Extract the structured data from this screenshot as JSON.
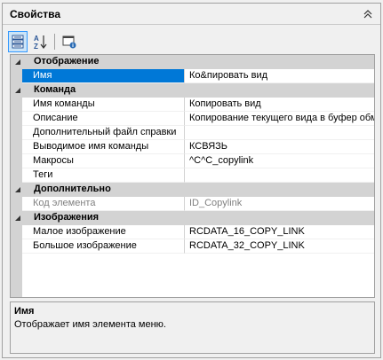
{
  "panel": {
    "title": "Свойства"
  },
  "toolbar": {
    "buttons": [
      {
        "name": "categorized-view",
        "active": true
      },
      {
        "name": "alphabetical-sort",
        "active": false
      },
      {
        "name": "property-pages",
        "active": false
      }
    ]
  },
  "grid": {
    "categories": [
      {
        "label": "Отображение",
        "properties": [
          {
            "name": "Имя",
            "value": "Ко&пировать вид",
            "selected": true
          }
        ]
      },
      {
        "label": "Команда",
        "properties": [
          {
            "name": "Имя команды",
            "value": "Копировать вид"
          },
          {
            "name": "Описание",
            "value": "Копирование текущего вида в буфер обм"
          },
          {
            "name": "Дополнительный файл справки",
            "value": ""
          },
          {
            "name": "Выводимое имя команды",
            "value": "КСВЯЗЬ"
          },
          {
            "name": "Макросы",
            "value": "^C^C_copylink"
          },
          {
            "name": "Теги",
            "value": ""
          }
        ]
      },
      {
        "label": "Дополнительно",
        "properties": [
          {
            "name": "Код элемента",
            "value": "ID_Copylink",
            "disabled": true
          }
        ]
      },
      {
        "label": "Изображения",
        "properties": [
          {
            "name": "Малое изображение",
            "value": "RCDATA_16_COPY_LINK"
          },
          {
            "name": "Большое изображение",
            "value": "RCDATA_32_COPY_LINK"
          }
        ]
      }
    ]
  },
  "help": {
    "title": "Имя",
    "description": "Отображает имя элемента меню."
  }
}
